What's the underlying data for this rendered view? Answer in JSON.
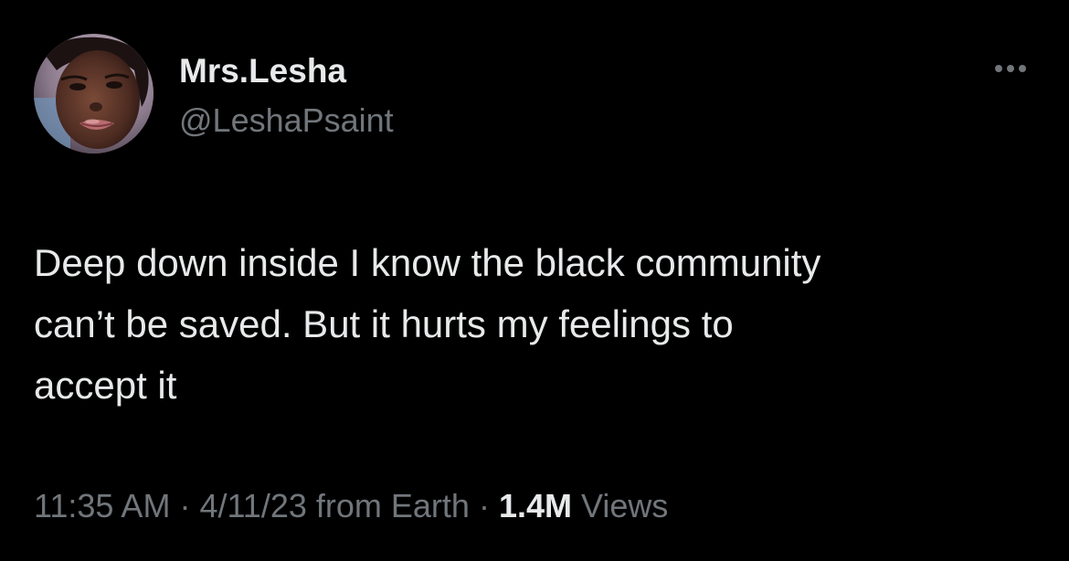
{
  "author": {
    "display_name": "Mrs.Lesha",
    "handle": "@LeshaPsaint",
    "avatar_icon": "profile-photo"
  },
  "tweet": {
    "lines": [
      "Deep down inside I know the black community",
      "can’t be saved. But it hurts my feelings to",
      "accept it"
    ]
  },
  "meta": {
    "time": "11:35 AM",
    "separator": " · ",
    "date": "4/11/23",
    "source": " from Earth",
    "views_count": "1.4M",
    "views_label": " Views"
  },
  "more_icon": "more-horizontal-icon",
  "colors": {
    "background": "#000000",
    "primary_text": "#e7e9ea",
    "secondary_text": "#71767b"
  }
}
